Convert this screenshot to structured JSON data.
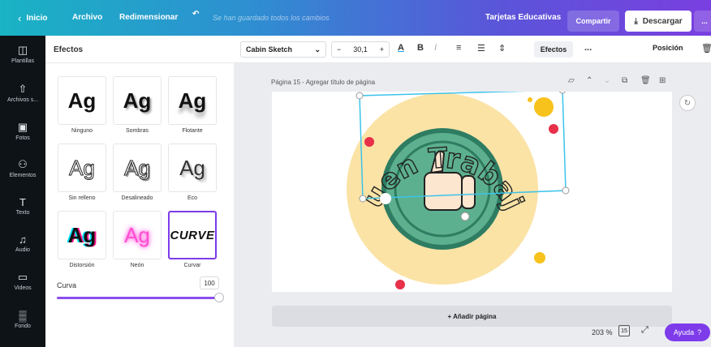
{
  "topbar": {
    "back_label": "Inicio",
    "archivo": "Archivo",
    "redimensionar": "Redimensionar",
    "saved_status": "Se han guardado todos los cambios",
    "design_title": "Tarjetas Educativas",
    "share": "Compartir",
    "download": "Descargar",
    "more": "..."
  },
  "rail": {
    "items": [
      {
        "label": "Plantillas",
        "icon": "template-icon"
      },
      {
        "label": "Archivos s...",
        "icon": "upload-icon"
      },
      {
        "label": "Fotos",
        "icon": "photo-icon"
      },
      {
        "label": "Elementos",
        "icon": "elements-icon"
      },
      {
        "label": "Texto",
        "icon": "text-icon"
      },
      {
        "label": "Audio",
        "icon": "audio-icon"
      },
      {
        "label": "Videos",
        "icon": "video-icon"
      },
      {
        "label": "Fondo",
        "icon": "background-icon"
      }
    ]
  },
  "effects_panel": {
    "title": "Efectos",
    "effects": [
      {
        "label": "Ninguno",
        "sample": "Ag"
      },
      {
        "label": "Sombras",
        "sample": "Ag"
      },
      {
        "label": "Flotante",
        "sample": "Ag"
      },
      {
        "label": "Sin relleno",
        "sample": "Ag"
      },
      {
        "label": "Desalineado",
        "sample": "Ag"
      },
      {
        "label": "Eco",
        "sample": "Ag"
      },
      {
        "label": "Distorsión",
        "sample": "Ag"
      },
      {
        "label": "Neón",
        "sample": "Ag"
      },
      {
        "label": "Curvar",
        "sample": "CURVE",
        "selected": true
      }
    ],
    "curve_label": "Curva",
    "curve_value": "100",
    "curve_fraction": 1.0
  },
  "text_toolbar": {
    "font": "Cabin Sketch",
    "size": "30,1",
    "minus": "−",
    "plus": "+",
    "efectos": "Efectos",
    "more": "...",
    "posicion": "Posición"
  },
  "canvas": {
    "page_label": "Página 15 - Agregar título de página",
    "design_text": "Buen Trabajo",
    "add_page": "+ Añadir página",
    "zoom": "203 %",
    "page_count": "15",
    "help": "Ayuda",
    "help_q": "?"
  },
  "colors": {
    "accent": "#7d3bea",
    "circle_outer": "#fbe3a6",
    "circle_ring": "#2e7d62",
    "circle_fill": "#5db08f",
    "dot_red": "#e8304a",
    "dot_yellow": "#f7c21b"
  }
}
